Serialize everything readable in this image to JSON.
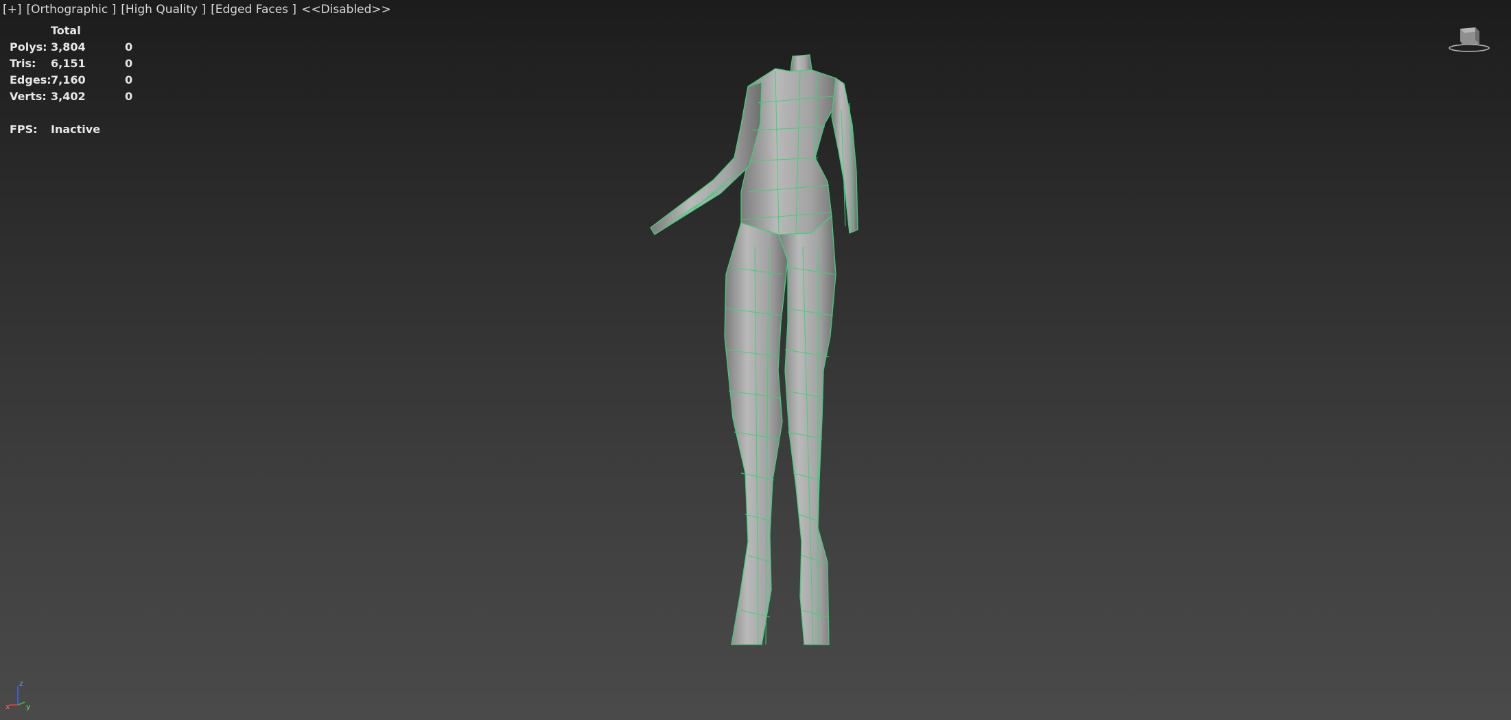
{
  "viewport": {
    "labels": [
      "[+]",
      "[Orthographic ]",
      "[High Quality ]",
      "[Edged Faces ]",
      "<<Disabled>>"
    ]
  },
  "stats": {
    "header": "Total",
    "rows": [
      {
        "label": "Polys:",
        "total": "3,804",
        "selected": "0"
      },
      {
        "label": "Tris:",
        "total": "6,151",
        "selected": "0"
      },
      {
        "label": "Edges:",
        "total": "7,160",
        "selected": "0"
      },
      {
        "label": "Verts:",
        "total": "3,402",
        "selected": "0"
      }
    ],
    "fps_label": "FPS:",
    "fps_value": "Inactive"
  },
  "axis": {
    "z": "z",
    "x": "x",
    "y": "y"
  },
  "colors": {
    "wireframe": "#3fd07a",
    "mesh": "#a9a9a9",
    "axis_x": "#d23b3b",
    "axis_y": "#3cb43c",
    "axis_z": "#3b5fd2"
  },
  "icons": [
    "viewcube-icon",
    "axis-tripod-icon"
  ]
}
